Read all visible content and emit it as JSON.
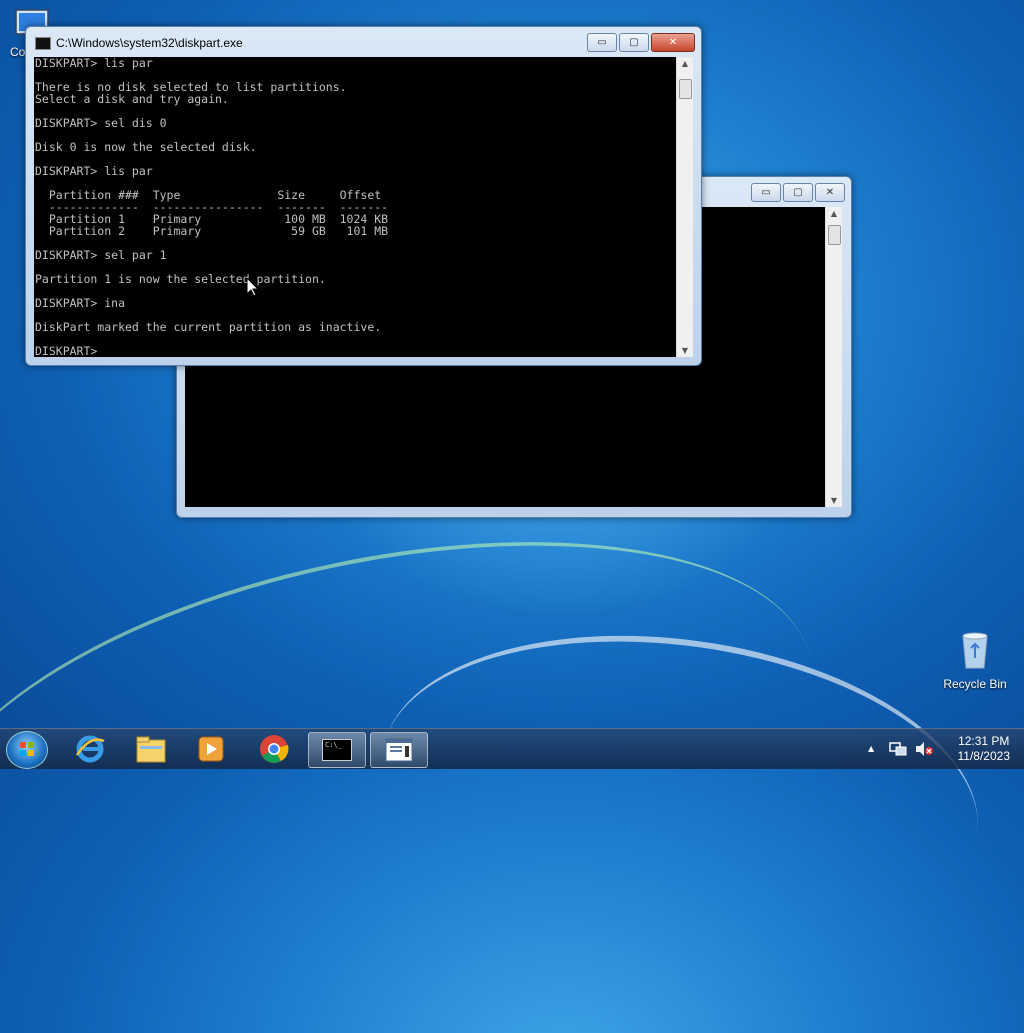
{
  "desktop": {
    "computer_label": "Co",
    "recycle_label": "Recycle Bin"
  },
  "front_window": {
    "title": "C:\\Windows\\system32\\diskpart.exe",
    "lines": [
      "DISKPART> lis par",
      "",
      "There is no disk selected to list partitions.",
      "Select a disk and try again.",
      "",
      "DISKPART> sel dis 0",
      "",
      "Disk 0 is now the selected disk.",
      "",
      "DISKPART> lis par",
      "",
      "  Partition ###  Type              Size     Offset",
      "  -------------  ----------------  -------  -------",
      "  Partition 1    Primary            100 MB  1024 KB",
      "  Partition 2    Primary             59 GB   101 MB",
      "",
      "DISKPART> sel par 1",
      "",
      "Partition 1 is now the selected partition.",
      "",
      "DISKPART> ina",
      "",
      "DiskPart marked the current partition as inactive.",
      "",
      "DISKPART>"
    ]
  },
  "controls": {
    "minimize": "▭",
    "maximize": "▢",
    "close": "✕"
  },
  "taskbar": {
    "clock_time": "12:31 PM",
    "clock_date": "11/8/2023",
    "cmd_icon_text": "C:\\_",
    "tray_arrow": "▲"
  }
}
